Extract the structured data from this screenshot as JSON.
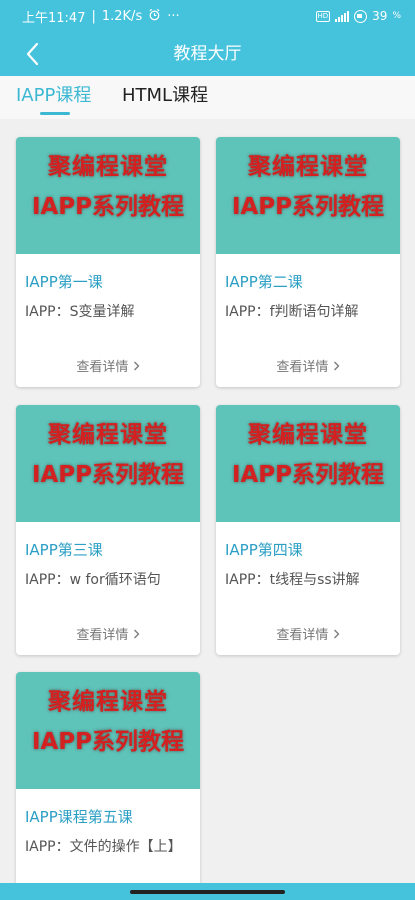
{
  "status": {
    "time": "上午11:47",
    "speed": "1.2K/s",
    "dots": "···",
    "hd": "HD",
    "battery": "39"
  },
  "app_bar": {
    "title": "教程大厅"
  },
  "tabs": [
    {
      "label": "IAPP课程",
      "active": true
    },
    {
      "label": "HTML课程",
      "active": false
    }
  ],
  "banner": {
    "line1": "聚编程课堂",
    "line2": "IAPP系列教程"
  },
  "more_label": "查看详情",
  "cards": [
    {
      "title": "IAPP第一课",
      "desc": "IAPP：S变量详解"
    },
    {
      "title": "IAPP第二课",
      "desc": "IAPP：f判断语句详解"
    },
    {
      "title": "IAPP第三课",
      "desc": "IAPP：w for循环语句"
    },
    {
      "title": "IAPP第四课",
      "desc": "IAPP：t线程与ss讲解"
    },
    {
      "title": "IAPP课程第五课",
      "desc": "IAPP：文件的操作【上】"
    }
  ],
  "colors": {
    "primary": "#45c2dc",
    "accent": "#3cb8d3",
    "card_title": "#2c9fc5",
    "banner_bg": "#5ec3b9",
    "banner_text": "#d32020"
  }
}
